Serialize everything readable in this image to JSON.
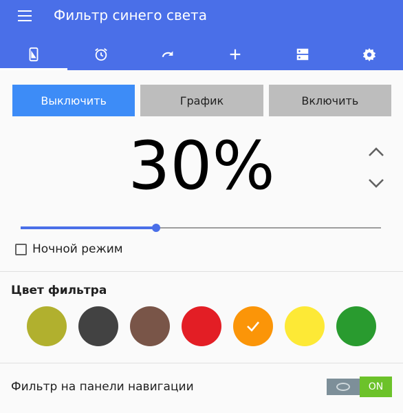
{
  "app": {
    "title": "Фильтр синего света"
  },
  "tabs": [
    {
      "icon": "phone-icon",
      "active": true
    },
    {
      "icon": "alarm-icon",
      "active": false
    },
    {
      "icon": "redo-icon",
      "active": false
    },
    {
      "icon": "plus-icon",
      "active": false
    },
    {
      "icon": "storage-icon",
      "active": false
    },
    {
      "icon": "gear-icon",
      "active": false
    }
  ],
  "mode_buttons": [
    {
      "label": "Выключить",
      "active": true
    },
    {
      "label": "График",
      "active": false
    },
    {
      "label": "Включить",
      "active": false
    }
  ],
  "filter": {
    "percent_text": "30%",
    "level": 0.375
  },
  "night_mode": {
    "label": "Ночной режим",
    "checked": false
  },
  "filter_color": {
    "title": "Цвет фильтра",
    "colors": [
      "#b1b02e",
      "#424242",
      "#795548",
      "#e31e25",
      "#fb9508",
      "#fde936",
      "#299b2f"
    ],
    "selected_index": 4
  },
  "nav_filter": {
    "label": "Фильтр на панели навигации",
    "toggle_on_text": "ON",
    "enabled": true
  },
  "colors": {
    "accent": "#4a6fe8",
    "button_active": "#3d8cf7",
    "toggle_on": "#6cc22a"
  }
}
